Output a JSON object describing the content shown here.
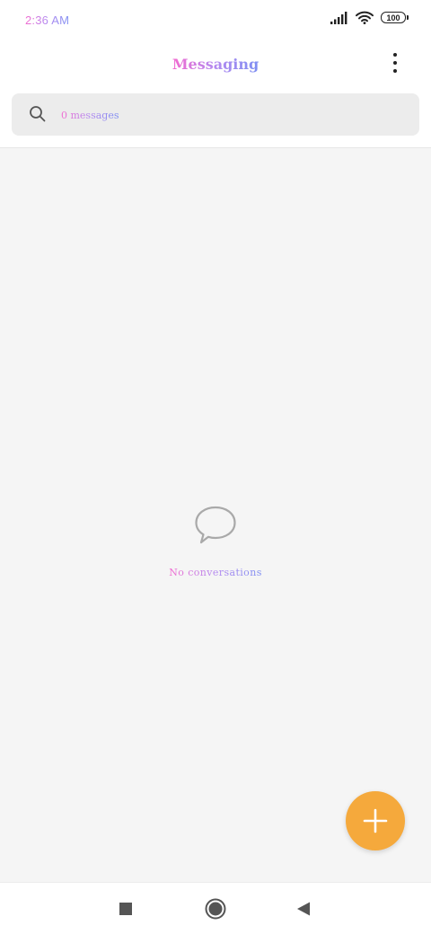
{
  "status_bar": {
    "time": "2:36 AM",
    "battery": "100",
    "icons": [
      "signal-icon",
      "wifi-icon",
      "battery-icon"
    ]
  },
  "app_bar": {
    "title": "Messaging",
    "menu_icon": "more-vert-icon"
  },
  "search": {
    "placeholder": "0 messages",
    "icon": "search-icon"
  },
  "empty_state": {
    "icon": "chat-bubble-icon",
    "text": "No conversations"
  },
  "fab": {
    "icon": "plus-icon",
    "color": "#f5a93c"
  },
  "nav_bar": {
    "buttons": [
      "recents-square-icon",
      "home-circle-icon",
      "back-triangle-icon"
    ]
  },
  "colors": {
    "accent_gradient_start": "#f26bd0",
    "accent_gradient_end": "#7e8ff2",
    "fab": "#f5a93c",
    "background": "#f5f5f5"
  }
}
